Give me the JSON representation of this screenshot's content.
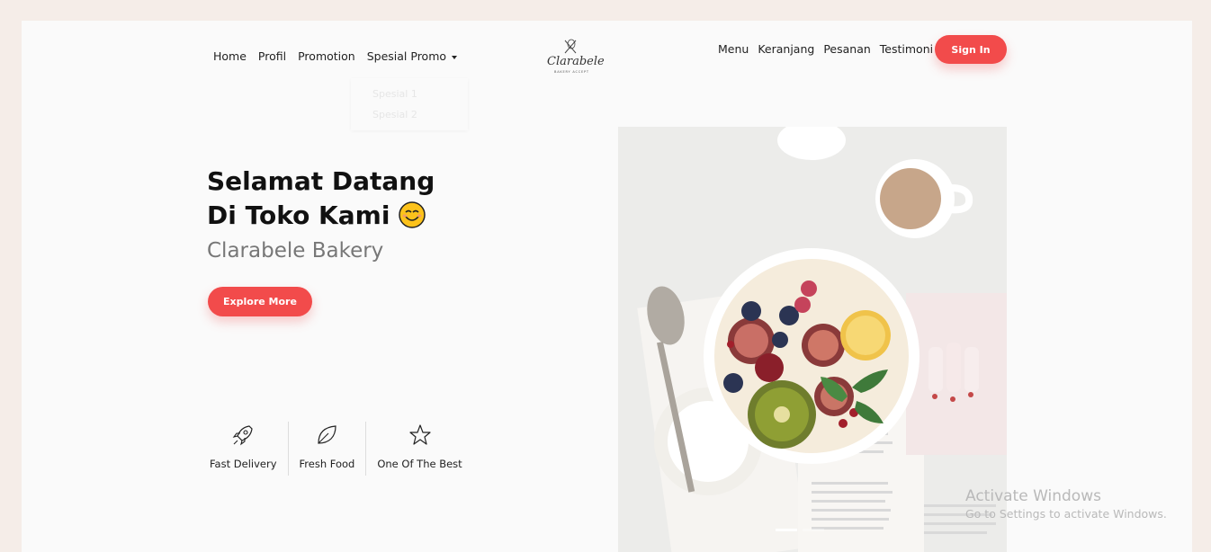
{
  "nav": {
    "left": [
      "Home",
      "Profil",
      "Promotion",
      "Spesial Promo"
    ],
    "dropdown": [
      "Spesial 1",
      "Spesial 2"
    ],
    "right": [
      "Menu",
      "Keranjang",
      "Pesanan",
      "Testimoni"
    ],
    "signin_label": "Sign In"
  },
  "logo": {
    "name": "Clarabele",
    "tagline": "BAKERY ACCEPT"
  },
  "hero": {
    "title_line1": "Selamat Datang",
    "title_line2": "Di Toko Kami",
    "subtitle": "Clarabele Bakery",
    "cta_label": "Explore More"
  },
  "features": [
    {
      "label": "Fast Delivery",
      "icon": "rocket-icon"
    },
    {
      "label": "Fresh Food",
      "icon": "leaf-icon"
    },
    {
      "label": "One Of The Best",
      "icon": "star-icon"
    }
  ],
  "carousel": {
    "slides": 2,
    "active": 1
  },
  "watermark": {
    "title": "Activate Windows",
    "subtitle": "Go to Settings to activate Windows."
  },
  "colors": {
    "accent": "#f24b4b",
    "background": "#fafafa",
    "outer": "#f5ede8"
  }
}
